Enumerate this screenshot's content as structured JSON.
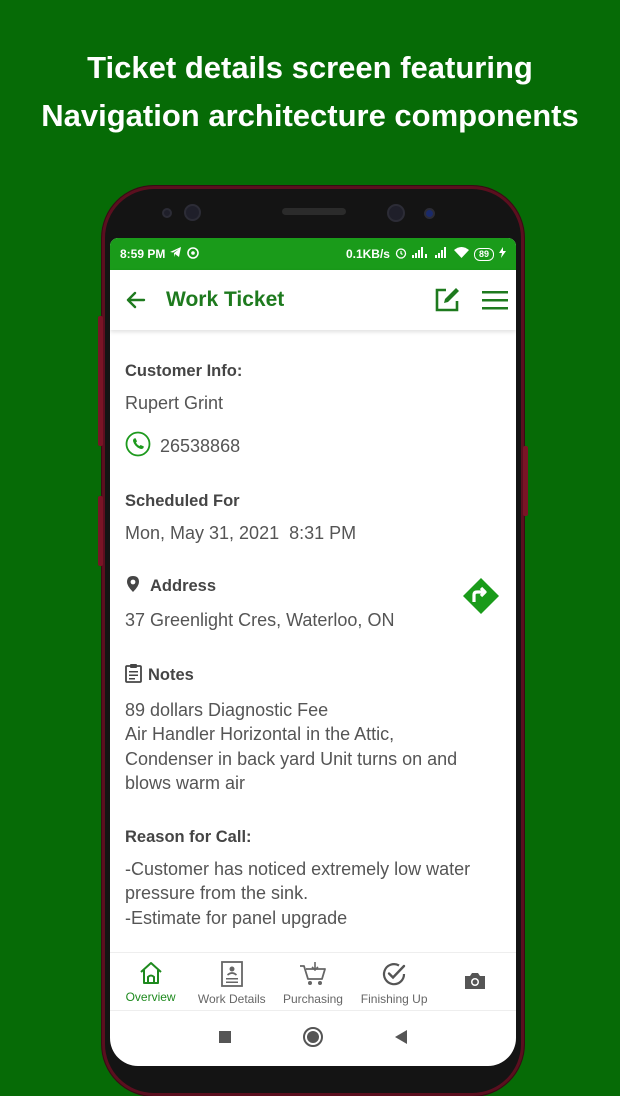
{
  "promo": {
    "headline_line1": "Ticket details screen featuring",
    "headline_line2": "Navigation architecture components"
  },
  "status_bar": {
    "time": "8:59 PM",
    "speed": "0.1KB/s",
    "battery": "89"
  },
  "app_bar": {
    "title": "Work Ticket"
  },
  "customer": {
    "label": "Customer Info:",
    "name": "Rupert Grint",
    "phone": "26538868"
  },
  "schedule": {
    "label": "Scheduled For",
    "date": "Mon, May 31, 2021",
    "time": "8:31 PM"
  },
  "address": {
    "label": "Address",
    "value": "37 Greenlight Cres, Waterloo, ON"
  },
  "notes": {
    "label": "Notes",
    "lines": [
      "89 dollars Diagnostic Fee",
      "Air Handler Horizontal in the Attic,",
      "Condenser in back yard Unit turns on and",
      "blows warm air"
    ]
  },
  "reason": {
    "label": "Reason for Call:",
    "lines": [
      "-Customer has noticed extremely low water",
      "pressure from the sink.",
      "-Estimate for panel upgrade"
    ]
  },
  "bottom_nav": {
    "items": [
      {
        "label": "Overview",
        "icon": "home-icon",
        "active": true
      },
      {
        "label": "Work Details",
        "icon": "document-icon",
        "active": false
      },
      {
        "label": "Purchasing",
        "icon": "cart-icon",
        "active": false
      },
      {
        "label": "Finishing Up",
        "icon": "check-circle-icon",
        "active": false
      },
      {
        "label": "",
        "icon": "camera-icon",
        "active": false
      }
    ]
  },
  "colors": {
    "background": "#066b06",
    "status_bar": "#1a9b1a",
    "accent": "#1e7a1e",
    "directions": "#1a9b1a"
  }
}
